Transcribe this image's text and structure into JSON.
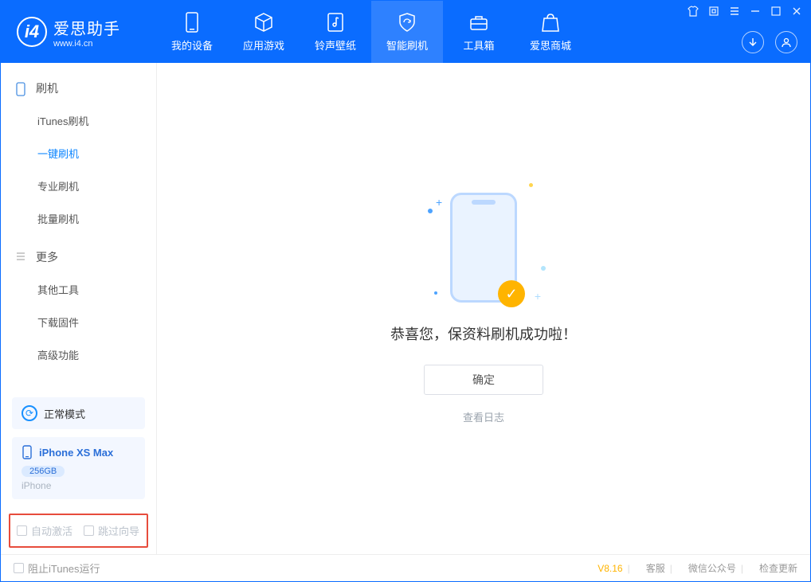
{
  "app": {
    "name": "爱思助手",
    "url": "www.i4.cn"
  },
  "nav": {
    "items": [
      {
        "label": "我的设备"
      },
      {
        "label": "应用游戏"
      },
      {
        "label": "铃声壁纸"
      },
      {
        "label": "智能刷机"
      },
      {
        "label": "工具箱"
      },
      {
        "label": "爱思商城"
      }
    ],
    "activeIndex": 3
  },
  "sidebar": {
    "group1": {
      "title": "刷机",
      "items": [
        "iTunes刷机",
        "一键刷机",
        "专业刷机",
        "批量刷机"
      ],
      "activeIndex": 1
    },
    "group2": {
      "title": "更多",
      "items": [
        "其他工具",
        "下载固件",
        "高级功能"
      ]
    }
  },
  "device": {
    "mode": "正常模式",
    "name": "iPhone XS Max",
    "storage": "256GB",
    "type": "iPhone"
  },
  "options": {
    "auto_activate": "自动激活",
    "skip_wizard": "跳过向导"
  },
  "content": {
    "message": "恭喜您，保资料刷机成功啦！",
    "ok": "确定",
    "view_log": "查看日志"
  },
  "statusbar": {
    "block_itunes": "阻止iTunes运行",
    "version": "V8.16",
    "service": "客服",
    "wechat": "微信公众号",
    "update": "检查更新"
  }
}
